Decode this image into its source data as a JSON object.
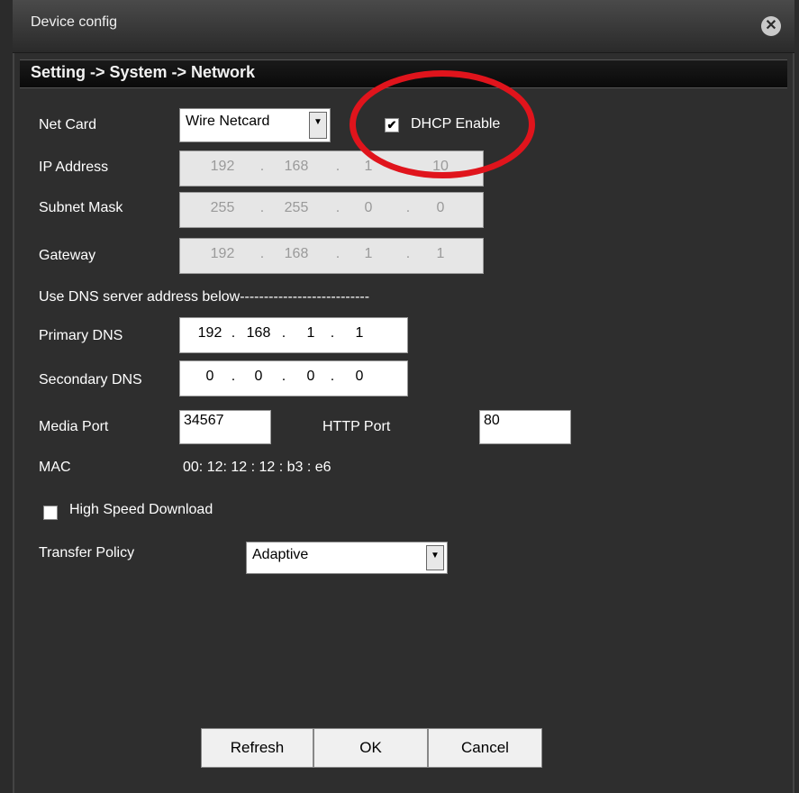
{
  "window": {
    "title": "Device config",
    "close_icon": "close-icon"
  },
  "breadcrumb": "Setting -> System -> Network",
  "net_card": {
    "label": "Net Card",
    "value": "Wire Netcard"
  },
  "dhcp": {
    "label": "DHCP Enable",
    "checked": true
  },
  "ip_address": {
    "label": "IP Address",
    "octets": [
      "192",
      "168",
      "1",
      "10"
    ]
  },
  "subnet_mask": {
    "label": "Subnet Mask",
    "octets": [
      "255",
      "255",
      "0",
      "0"
    ]
  },
  "gateway": {
    "label": "Gateway",
    "octets": [
      "192",
      "168",
      "1",
      "1"
    ]
  },
  "dns_section": {
    "label": "Use DNS server address below---------------------------"
  },
  "primary_dns": {
    "label": "Primary DNS",
    "octets": [
      "192",
      "168",
      "1",
      "1"
    ]
  },
  "secondary_dns": {
    "label": "Secondary DNS",
    "octets": [
      "0",
      "0",
      "0",
      "0"
    ]
  },
  "media_port": {
    "label": "Media Port",
    "value": "34567"
  },
  "http_port": {
    "label": "HTTP Port",
    "value": "80"
  },
  "mac": {
    "label": "MAC",
    "value": "00: 12: 12 : 12 : b3 : e6"
  },
  "high_speed_download": {
    "label": "High Speed Download",
    "checked": false
  },
  "transfer_policy": {
    "label": "Transfer Policy",
    "value": "Adaptive"
  },
  "buttons": {
    "refresh": "Refresh",
    "ok": "OK",
    "cancel": "Cancel"
  },
  "colors": {
    "highlight_oval": "#e0141c",
    "background": "#2e2e2e"
  }
}
